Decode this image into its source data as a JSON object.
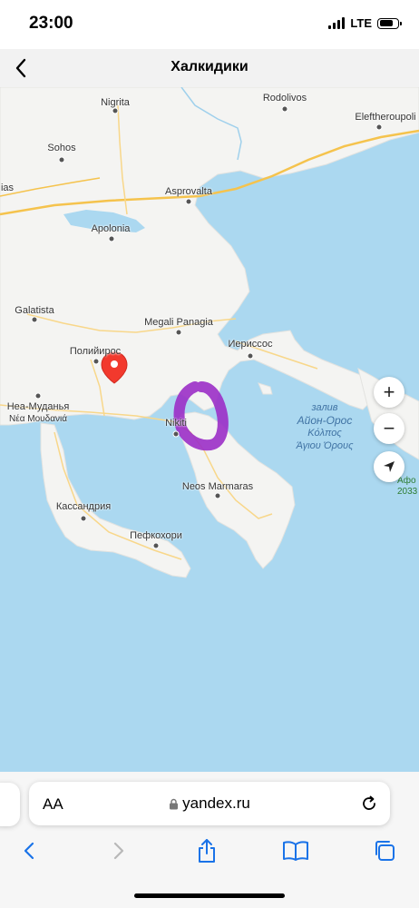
{
  "status_bar": {
    "time": "23:00",
    "network": "LTE",
    "battery_level": 0.75
  },
  "header": {
    "title": "Халкидики"
  },
  "map": {
    "places": {
      "nigrita": "Nigrita",
      "rodolivos": "Rodolivos",
      "eleftheroupoli": "Eleftheroupoli",
      "sohos": "Sohos",
      "edge_left": "ias",
      "asprovalta": "Asprovalta",
      "apolonia": "Apolonia",
      "galatista": "Galatista",
      "megali_panagia": "Megali Panagia",
      "ierissos": "Иериссос",
      "poligiros": "Полийирос",
      "nea_moudania": "Неа-Муданья",
      "nea_moudania_gr": "Νέα Μουδανιά",
      "nikiti": "Nikiti",
      "neos_marmaras": "Neos Marmaras",
      "kassandria": "Кассандрия",
      "pefkohori": "Пефкохори"
    },
    "sea": {
      "line1": "залив",
      "line2": "Айон-Орос",
      "line3": "Κόλπος",
      "line4": "Άγιου Όρους"
    },
    "peak": {
      "name": "Афо",
      "elevation": "2033"
    },
    "controls": {
      "zoom_in": "+",
      "zoom_out": "−"
    },
    "colors": {
      "water": "#abd8f0",
      "land": "#f4f4f2",
      "road": "#f5c34d",
      "pin": "#f2392d",
      "annotation": "#9b2fc6"
    }
  },
  "browser": {
    "text_size": "AA",
    "url": "yandex.ru"
  }
}
